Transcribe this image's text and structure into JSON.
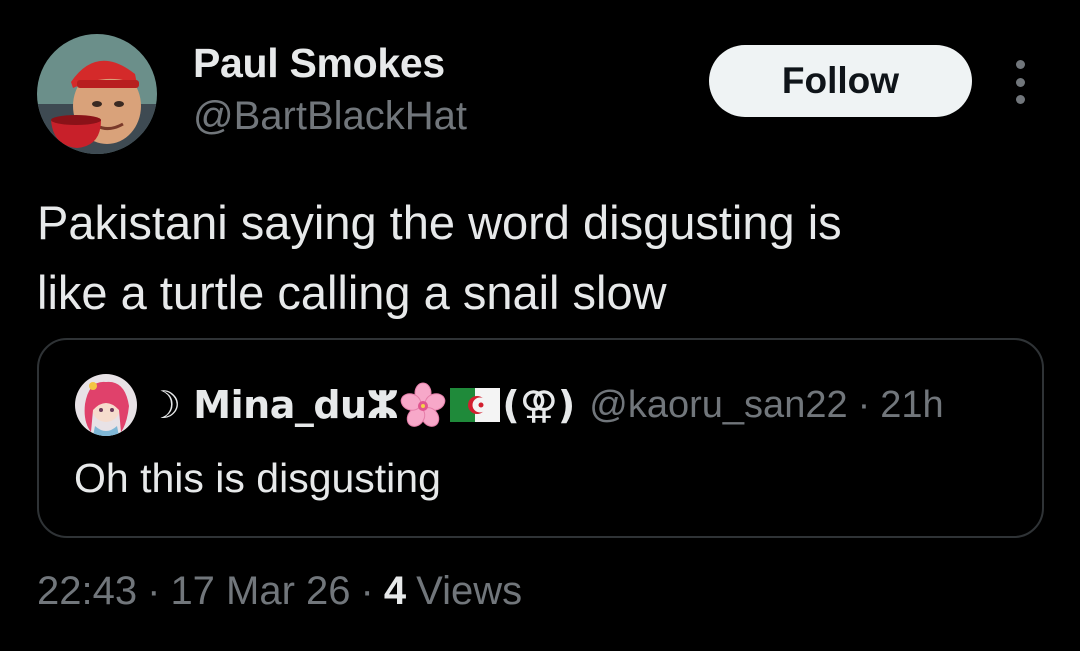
{
  "author": {
    "name": "Paul Smokes",
    "handle": "@BartBlackHat"
  },
  "follow_label": "Follow",
  "tweet": {
    "line1": "Pakistani saying the word disgusting is",
    "line2": "like a turtle calling a snail slow"
  },
  "quote": {
    "name": "☽ Mina_duⵣ",
    "name_tail": "(⚢)",
    "handle": "@kaoru_san22",
    "separator": "·",
    "time": "21h",
    "text": "Oh this is disgusting"
  },
  "meta": {
    "time": "22:43",
    "separator": "·",
    "date": "17 Mar 26",
    "views_count": "4",
    "views_label": "Views"
  },
  "icons": {
    "more": "more-vertical-icon",
    "flower": "cherry-blossom-icon",
    "flag": "algeria-flag-icon"
  },
  "colors": {
    "background": "#000000",
    "primary_text": "#e7e9ea",
    "secondary_text": "#71767b",
    "border": "#2f3336",
    "button_bg": "#eff3f4"
  }
}
